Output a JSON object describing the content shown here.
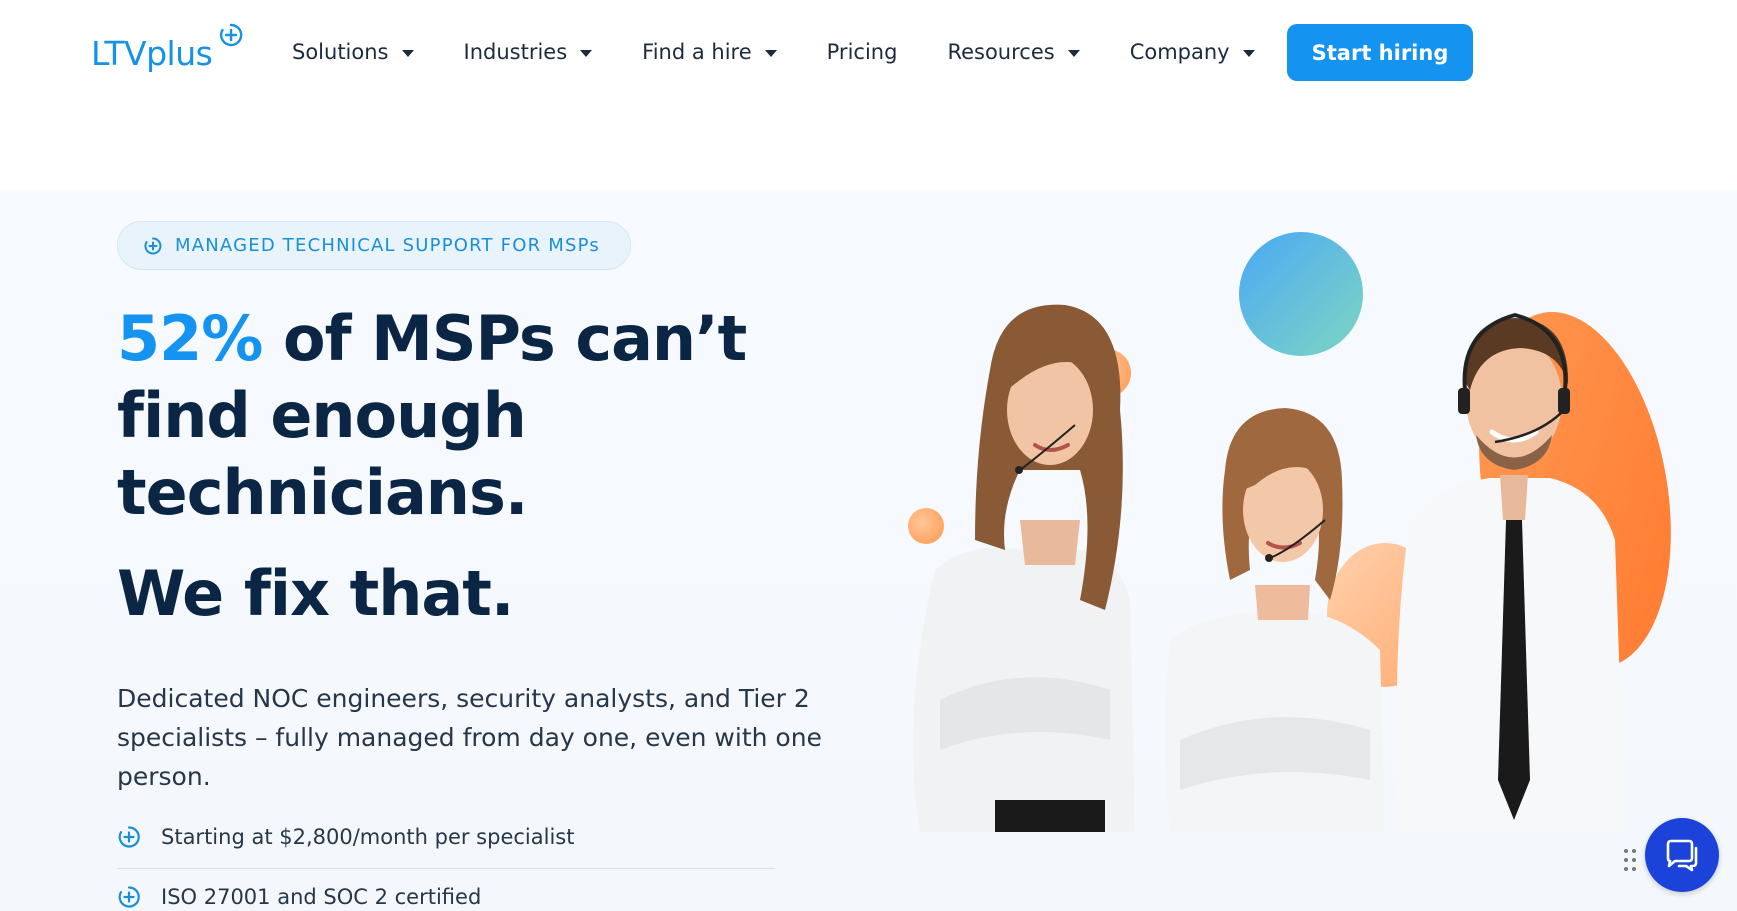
{
  "brand": {
    "logo_text": "LTVplus",
    "accent": "#1493f0",
    "dark": "#0b2545"
  },
  "nav": {
    "items": [
      {
        "label": "Solutions",
        "dropdown": true
      },
      {
        "label": "Industries",
        "dropdown": true
      },
      {
        "label": "Find a hire",
        "dropdown": true
      },
      {
        "label": "Pricing",
        "dropdown": false
      },
      {
        "label": "Resources",
        "dropdown": true
      },
      {
        "label": "Company",
        "dropdown": true
      }
    ],
    "cta": "Start hiring"
  },
  "hero": {
    "badge": "MANAGED TECHNICAL SUPPORT FOR MSPs",
    "headline_highlight": "52%",
    "headline_line1_rest": " of MSPs can’t",
    "headline_line2": "find enough",
    "headline_line3": "technicians.",
    "headline_fix": "We fix that.",
    "description": "Dedicated NOC engineers, security analysts, and Tier 2 specialists – fully managed from day one, even with one person.",
    "bullets": [
      "Starting at $2,800/month per specialist",
      "ISO 27001 and SOC 2 certified"
    ]
  },
  "icons": {
    "logo": "plus-circle-icon",
    "badge": "plus-circle-icon",
    "bullet": "plus-circle-icon",
    "chat": "chat-bubbles-icon",
    "drag": "drag-dots-icon"
  }
}
